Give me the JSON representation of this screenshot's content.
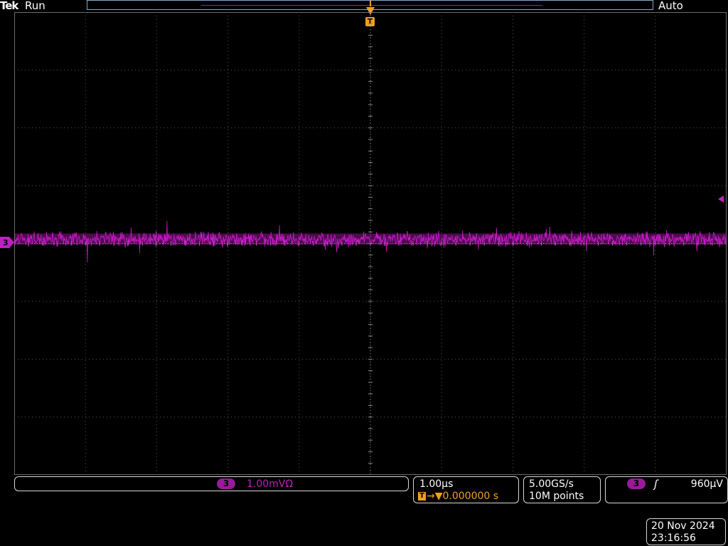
{
  "header": {
    "brand": "Tek",
    "acq_state": "Run",
    "trigger_mode": "Auto"
  },
  "trigger": {
    "marker_label": "T"
  },
  "channel": {
    "number": "3",
    "scale": "1.00mVΩ",
    "color": "#e020e0"
  },
  "timebase": {
    "scale": "1.00µs",
    "position": "0.000000 s"
  },
  "acquisition": {
    "sample_rate": "5.00GS/s",
    "record_length": "10M points"
  },
  "trigger_readout": {
    "source": "3",
    "slope_symbol": "ʃ",
    "level": "960µV"
  },
  "datetime": {
    "date": "20 Nov 2024",
    "time": "23:16:56"
  },
  "chart_data": {
    "type": "line",
    "title": "",
    "xlabel": "",
    "ylabel": "",
    "divisions": {
      "horizontal": 10,
      "vertical": 8
    },
    "series": [
      {
        "name": "3",
        "description_values_divisions_from_center": "noise around offset",
        "offset_div": 0.1,
        "noise_pp_div": 0.35
      }
    ]
  }
}
